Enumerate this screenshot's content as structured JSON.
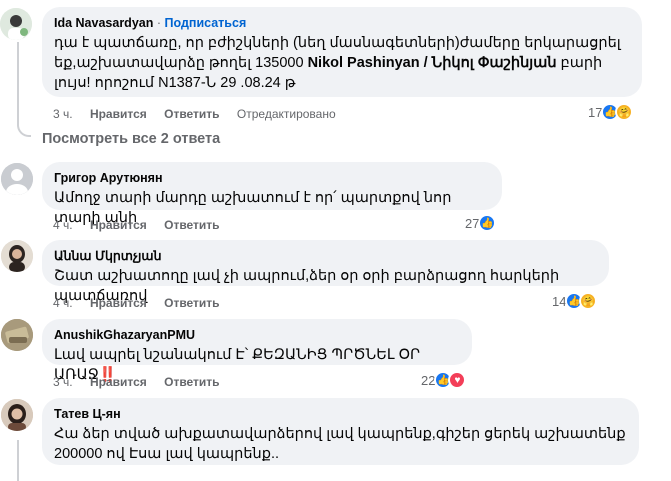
{
  "comments": [
    {
      "author": "Ida Navasardyan",
      "follow": "Подписаться",
      "text_before": "դա է պատճառը, որ բժիշկների (նեղ մասնագետների)ժամերը երկարացրել եք,աշխատավարձը թողել 135000 ",
      "text_bold": "Nikol Pashinyan / Նիկոլ Փաշինյան",
      "text_after": " բարի լույս! որոշում N1387-Ն 29 .08.24 թ",
      "time": "3 ч.",
      "like": "Нравится",
      "reply": "Ответить",
      "edited": "Отредактировано",
      "reaction_count": "17"
    },
    {
      "author": "Григор Арутюнян",
      "text": "Ամողջ տարի մարդը աշխատում է որ՛ պարտքով նոր տարի անի",
      "time": "4 ч.",
      "like": "Нравится",
      "reply": "Ответить",
      "reaction_count": "27"
    },
    {
      "author": "Աննա Մկրտչյան",
      "text": "Շատ աշխատողը լավ չի ապրում,ձեր օր օրի բարձրացող հարկերի պատճառով",
      "time": "4 ч.",
      "like": "Нравится",
      "reply": "Ответить",
      "reaction_count": "14"
    },
    {
      "author": "AnushikGhazaryanPMU",
      "text": "Լավ ապրել նշանակում Է՝ ՔԵԶԱՆԻՑ ՊՐԾՆԵԼ ՕՐ ԱՌԱՋ",
      "text_emoji": "‼️",
      "time": "3 ч.",
      "like": "Нравится",
      "reply": "Ответить",
      "reaction_count": "22"
    },
    {
      "author": "Татев Ц-ян",
      "text": "Հա ձեր տված ախքատավարձերով լավ կապրենք,գիշեր ցերեկ աշխատենք 200000 ով Էսա լավ կապրենք.."
    }
  ],
  "view_replies": "Посмотреть все 2 ответа",
  "colors": {
    "bubble": "#f0f2f5",
    "link": "#0064d1",
    "meta": "#65676b",
    "like": "#1877f2",
    "heart": "#f33e58"
  }
}
